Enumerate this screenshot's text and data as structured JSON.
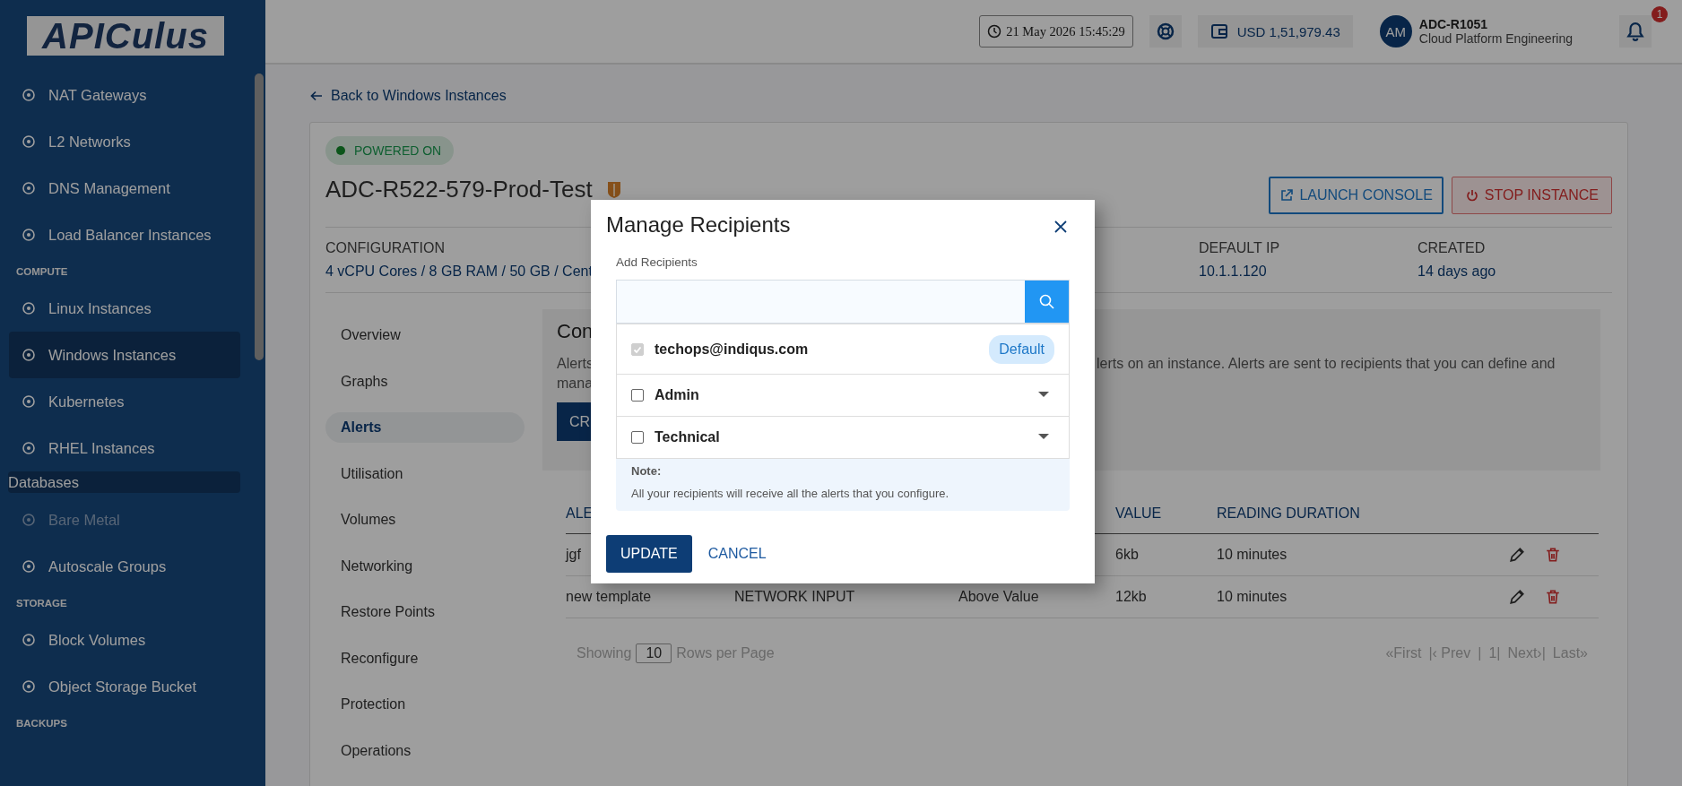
{
  "sidebar": {
    "logo": "APICulus",
    "items": [
      {
        "kind": "item",
        "label": "NAT Gateways",
        "selected": false,
        "disabled": false
      },
      {
        "kind": "item",
        "label": "L2 Networks",
        "selected": false,
        "disabled": false
      },
      {
        "kind": "item",
        "label": "DNS Management",
        "selected": false,
        "disabled": false
      },
      {
        "kind": "item",
        "label": "Load Balancer Instances",
        "selected": false,
        "disabled": false
      },
      {
        "kind": "section",
        "label": "COMPUTE"
      },
      {
        "kind": "item",
        "label": "Linux Instances",
        "selected": false,
        "disabled": false
      },
      {
        "kind": "item",
        "label": "Windows Instances",
        "selected": true,
        "disabled": false
      },
      {
        "kind": "item",
        "label": "Kubernetes",
        "selected": false,
        "disabled": false
      },
      {
        "kind": "item",
        "label": "RHEL Instances",
        "selected": false,
        "disabled": false
      },
      {
        "kind": "group",
        "label": "Databases"
      },
      {
        "kind": "item",
        "label": "Bare Metal",
        "selected": false,
        "disabled": true
      },
      {
        "kind": "item",
        "label": "Autoscale Groups",
        "selected": false,
        "disabled": false
      },
      {
        "kind": "section",
        "label": "STORAGE"
      },
      {
        "kind": "item",
        "label": "Block Volumes",
        "selected": false,
        "disabled": false
      },
      {
        "kind": "item",
        "label": "Object Storage Bucket",
        "selected": false,
        "disabled": false
      },
      {
        "kind": "section",
        "label": "BACKUPS"
      }
    ]
  },
  "header": {
    "datetime": "21 May 2026 15:45:29",
    "balance": "USD 1,51,979.43",
    "user": {
      "initials": "AM",
      "name": "ADC-R1051",
      "org": "Cloud Platform Engineering"
    },
    "notifications": "1"
  },
  "back_link": "Back to Windows Instances",
  "instance": {
    "status": {
      "label": "POWERED ON",
      "on": true
    },
    "name": "ADC-R522-579-Prod-Test",
    "buttons": [
      {
        "kind": "outline",
        "label": "LAUNCH CONSOLE"
      },
      {
        "kind": "danger",
        "label": "STOP INSTANCE"
      }
    ],
    "details": [
      {
        "label": "CONFIGURATION",
        "value": "4 vCPU Cores / 8 GB RAM / 50 GB / Cent"
      },
      {
        "label": "DEFAULT IP",
        "value": "10.1.1.120"
      },
      {
        "label": "CREATED",
        "value": "14 days ago"
      }
    ]
  },
  "tabs": [
    {
      "label": "Overview",
      "selected": false
    },
    {
      "label": "Graphs",
      "selected": false
    },
    {
      "label": "Alerts",
      "selected": true
    },
    {
      "label": "Utilisation",
      "selected": false
    },
    {
      "label": "Volumes",
      "selected": false
    },
    {
      "label": "Networking",
      "selected": false
    },
    {
      "label": "Restore Points",
      "selected": false
    },
    {
      "label": "Reconfigure",
      "selected": false
    },
    {
      "label": "Protection",
      "selected": false
    },
    {
      "label": "Operations",
      "selected": false
    }
  ],
  "alerts_panel": {
    "heading": "Con",
    "text_left": [
      "Alerts",
      "mana"
    ],
    "text_right": "lerts on an instance. Alerts are sent to recipients that you can define and",
    "button": "CR"
  },
  "table": {
    "columns": [
      "ALE",
      null,
      null,
      "VALUE",
      "READING DURATION"
    ],
    "rows": [
      {
        "cells": [
          "jgf",
          null,
          null,
          "6kb",
          "10 minutes"
        ]
      },
      {
        "cells": [
          "new template",
          "NETWORK INPUT",
          "Above Value",
          "12kb",
          "10 minutes"
        ]
      }
    ]
  },
  "pagination": {
    "showing": "Showing",
    "page_size": "10",
    "rows_label": "Rows per Page",
    "first": "«First",
    "prev": "|‹ Prev",
    "sep": "|",
    "page": "1|",
    "next": "Next›|",
    "last": "Last»"
  },
  "modal": {
    "title": "Manage Recipients",
    "field_label": "Add Recipients",
    "recipients": [
      {
        "kind": "email",
        "label": "techops@indiqus.com",
        "checked": true,
        "disabled": true,
        "tag": "Default"
      },
      {
        "kind": "group",
        "label": "Admin",
        "checked": false
      },
      {
        "kind": "group",
        "label": "Technical",
        "checked": false
      }
    ],
    "note_title": "Note:",
    "note": "All your recipients will receive all the alerts that you configure.",
    "buttons": [
      {
        "kind": "primary",
        "label": "UPDATE"
      },
      {
        "kind": "link",
        "label": "CANCEL"
      }
    ]
  }
}
